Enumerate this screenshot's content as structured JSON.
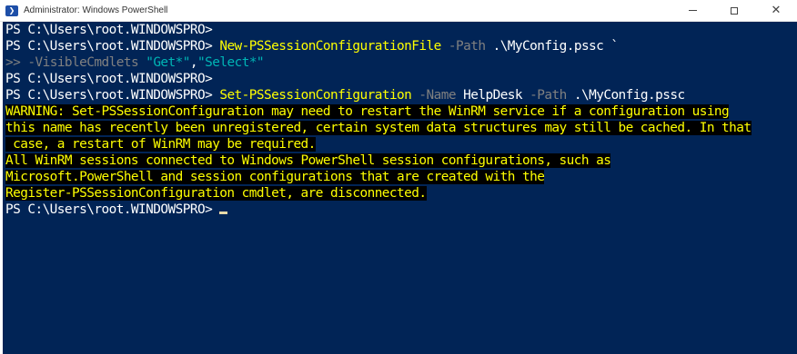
{
  "window": {
    "title": "Administrator: Windows PowerShell",
    "icon": "powershell-icon",
    "controls": {
      "minimize_icon": "minimize-icon",
      "maximize_icon": "maximize-icon",
      "close_icon": "close-icon"
    }
  },
  "colors": {
    "console_bg": "#012456",
    "command": "#ffff00",
    "parameter": "#808080",
    "string": "#00b5b5",
    "warning_fg": "#ffff00",
    "warning_bg": "#000000"
  },
  "console": {
    "line1": {
      "prompt": "PS C:\\Users\\root.WINDOWSPRO>"
    },
    "line2": {
      "prompt": "PS C:\\Users\\root.WINDOWSPRO>",
      "cmd": "New-PSSessionConfigurationFile",
      "param": "-Path",
      "arg": ".\\MyConfig.pssc `"
    },
    "line3": {
      "cont": ">>",
      "param": "-VisibleCmdlets",
      "str1": "\"Get*\"",
      "comma": ",",
      "str2": "\"Select*\""
    },
    "line4": {
      "prompt": "PS C:\\Users\\root.WINDOWSPRO>"
    },
    "line5": {
      "prompt": "PS C:\\Users\\root.WINDOWSPRO>",
      "cmd": "Set-PSSessionConfiguration",
      "param1": "-Name",
      "arg1": "HelpDesk",
      "param2": "-Path",
      "arg2": ".\\MyConfig.pssc"
    },
    "warning": [
      "WARNING: Set-PSSessionConfiguration may need to restart the WinRM service if a configuration using",
      "this name has recently been unregistered, certain system data structures may still be cached. In that",
      " case, a restart of WinRM may be required.",
      "All WinRM sessions connected to Windows PowerShell session configurations, such as",
      "Microsoft.PowerShell and session configurations that are created with the",
      "Register-PSSessionConfiguration cmdlet, are disconnected."
    ],
    "line_final": {
      "prompt": "PS C:\\Users\\root.WINDOWSPRO>"
    }
  }
}
